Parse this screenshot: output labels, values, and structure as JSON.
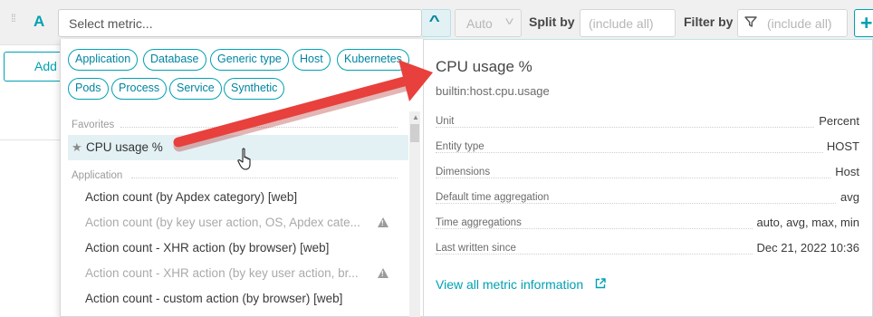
{
  "toolbar": {
    "query_label": "A",
    "metric_placeholder": "Select metric...",
    "aggregation": "Auto",
    "split_by_label": "Split by",
    "split_by_placeholder": "(include all)",
    "filter_by_label": "Filter by",
    "filter_by_placeholder": "(include all)",
    "add_symbol": "+"
  },
  "background": {
    "add_button_label": "Add"
  },
  "dropdown": {
    "chips": [
      "Application",
      "Database",
      "Generic type",
      "Host",
      "Kubernetes",
      "Pods",
      "Process",
      "Service",
      "Synthetic"
    ],
    "favorites_heading": "Favorites",
    "favorites": [
      {
        "label": "CPU usage %",
        "icon": "star-icon"
      }
    ],
    "application_heading": "Application",
    "items": [
      {
        "label": "Action count (by Apdex category) [web]",
        "enabled": true,
        "warning": false
      },
      {
        "label": "Action count (by key user action, OS, Apdex cate...",
        "enabled": false,
        "warning": true
      },
      {
        "label": "Action count - XHR action (by browser) [web]",
        "enabled": true,
        "warning": false
      },
      {
        "label": "Action count - XHR action (by key user action, br...",
        "enabled": false,
        "warning": true
      },
      {
        "label": "Action count - custom action (by browser) [web]",
        "enabled": true,
        "warning": false
      }
    ]
  },
  "detail": {
    "title": "CPU usage %",
    "metric_key": "builtin:host.cpu.usage",
    "rows": [
      {
        "label": "Unit",
        "value": "Percent"
      },
      {
        "label": "Entity type",
        "value": "HOST"
      },
      {
        "label": "Dimensions",
        "value": "Host"
      },
      {
        "label": "Default time aggregation",
        "value": "avg"
      },
      {
        "label": "Time aggregations",
        "value": "auto, avg, max, min"
      },
      {
        "label": "Last written since",
        "value": "Dec 21, 2022 10:36"
      }
    ],
    "link_label": "View all metric information"
  },
  "colors": {
    "accent": "#00a1b2",
    "highlight": "#e3f1f5",
    "arrow": "#e8403c"
  }
}
